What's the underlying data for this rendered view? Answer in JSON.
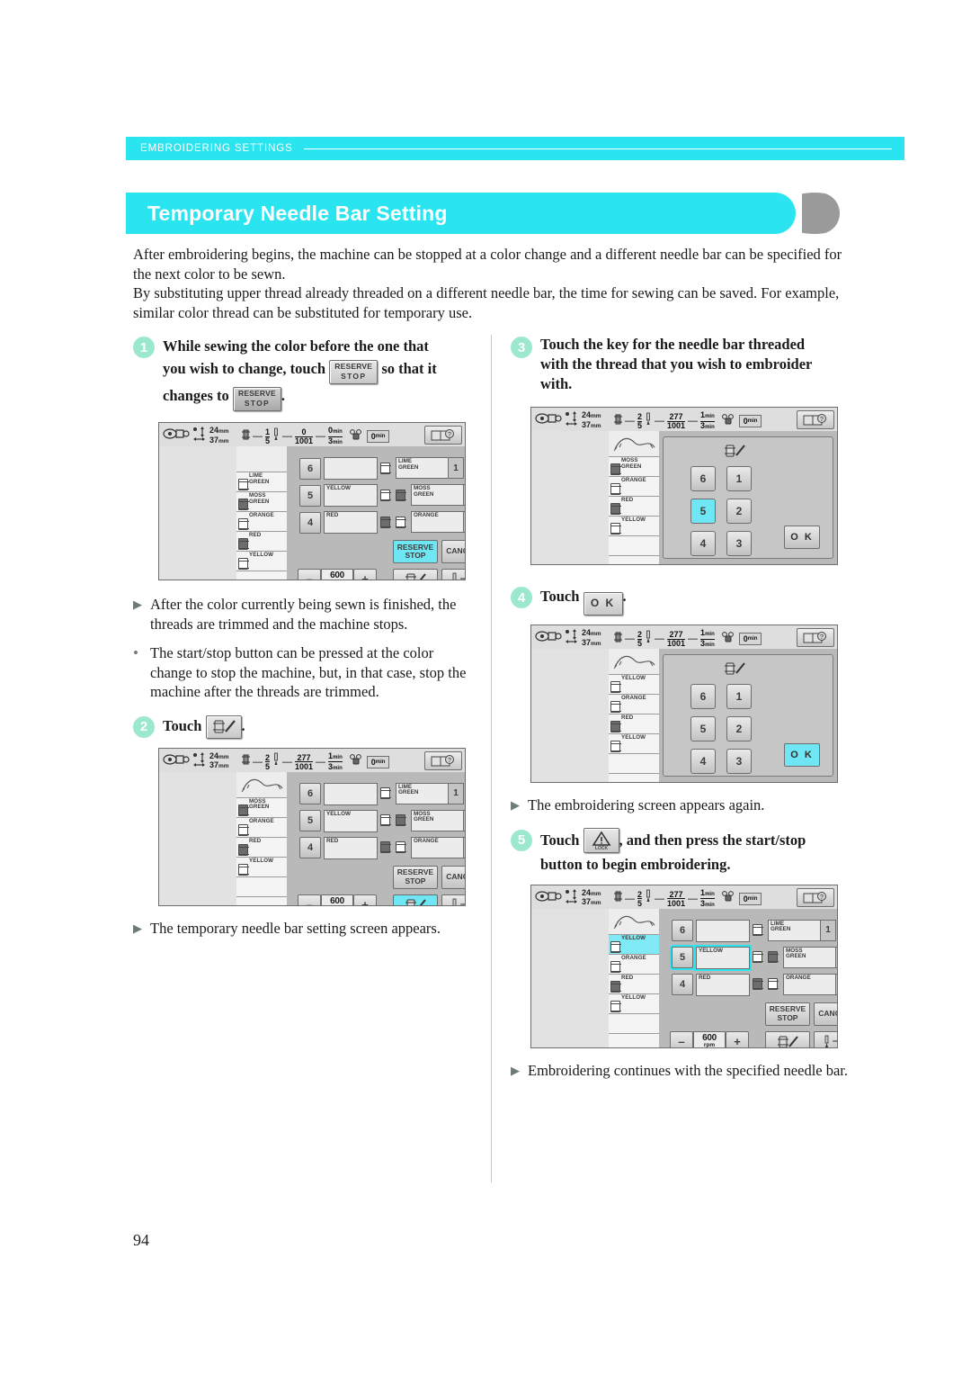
{
  "running_header": {
    "text": "EMBROIDERING SETTINGS"
  },
  "page_title": "Temporary Needle Bar Setting",
  "page_number": "94",
  "intro": {
    "p1": "After embroidering begins, the machine can be stopped at a color change and a different needle bar can be specified for the next color to be sewn.",
    "p2": "By substituting upper thread already threaded on a different needle bar, the time for sewing can be saved. For example, similar color thread can be substituted for temporary use."
  },
  "keys": {
    "reserve_line1": "RESERVE",
    "reserve_line2": "STOP",
    "ok": "O K",
    "cancel": "CANCEL",
    "lock": "LOCK",
    "speed_value": "600",
    "speed_unit": "rpm",
    "minus": "–",
    "plus": "+",
    "needle_pm": "–/+"
  },
  "steps": {
    "s1": {
      "num": "1",
      "t1": "While sewing the color before the one that",
      "t2a": "you wish to change, touch",
      "t2b": "so that it",
      "t3a": "changes to",
      "t3b": "."
    },
    "s2": {
      "num": "2",
      "label": "Touch",
      "tail": "."
    },
    "s3": {
      "num": "3",
      "t1": "Touch the key for the needle bar threaded",
      "t2": "with the thread that you wish to embroider",
      "t3": "with."
    },
    "s4": {
      "num": "4",
      "label": "Touch",
      "tail": "."
    },
    "s5": {
      "num": "5",
      "t1a": "Touch",
      "t1b": ", and then press the start/stop",
      "t2": "button to begin embroidering."
    }
  },
  "notes": {
    "n1": "After the color currently being sewn is finished, the threads are trimmed and the machine stops.",
    "n2": "The start/stop button can be pressed at the color change to stop the machine, but, in that case, stop the machine after the threads are trimmed.",
    "n3": "The temporary needle bar setting screen appears.",
    "n4": "The embroidering screen appears again.",
    "n5": "Embroidering continues with the specified needle bar."
  },
  "colors": {
    "accent_cyan": "#2ae4f0",
    "step_circle": "#9ce8cf",
    "lcd_bg": "#cfcfcf",
    "highlight": "#6fe6f3"
  },
  "lcd_screens": [
    {
      "id": "screen-step1",
      "size": {
        "height": "24",
        "width": "37",
        "unit": "mm"
      },
      "counter": {
        "color_current": "1",
        "color_total": "5",
        "stitch_current": "0",
        "stitch_total": "1001",
        "time_current": "0",
        "time_total": "3",
        "time_unit": "min",
        "elapsed": "0",
        "elapsed_unit": "min"
      },
      "thread_list": [
        {
          "name": "LIME GREEN",
          "index": "1",
          "shade": "light",
          "selected": false
        },
        {
          "name": "MOSS GREEN",
          "index": "2",
          "shade": "dark",
          "selected": false
        },
        {
          "name": "ORANGE",
          "index": "3",
          "shade": "light",
          "selected": false
        },
        {
          "name": "RED",
          "index": "4",
          "shade": "dark",
          "selected": false
        },
        {
          "name": "YELLOW",
          "index": "5",
          "shade": "light",
          "selected": false
        }
      ],
      "needle_left": [
        {
          "num": "6",
          "label": ""
        },
        {
          "num": "5",
          "label": "YELLOW"
        },
        {
          "num": "4",
          "label": "RED"
        }
      ],
      "needle_right": [
        {
          "label": "LIME GREEN",
          "num": "1"
        },
        {
          "label": "MOSS GREEN",
          "num": "2"
        },
        {
          "label": "ORANGE",
          "num": "3"
        }
      ],
      "reserve_active": true,
      "thread_button_active": false,
      "has_bottom_bar": true
    },
    {
      "id": "screen-step2",
      "size": {
        "height": "24",
        "width": "37",
        "unit": "mm"
      },
      "counter": {
        "color_current": "2",
        "color_total": "5",
        "stitch_current": "277",
        "stitch_total": "1001",
        "time_current": "1",
        "time_total": "3",
        "time_unit": "min",
        "elapsed": "0",
        "elapsed_unit": "min"
      },
      "thread_list": [
        {
          "name": "MOSS GREEN",
          "index": "2",
          "shade": "dark",
          "selected": false
        },
        {
          "name": "ORANGE",
          "index": "3",
          "shade": "light",
          "selected": false
        },
        {
          "name": "RED",
          "index": "4",
          "shade": "dark",
          "selected": false
        },
        {
          "name": "YELLOW",
          "index": "5",
          "shade": "light",
          "selected": false
        }
      ],
      "needle_left": [
        {
          "num": "6",
          "label": ""
        },
        {
          "num": "5",
          "label": "YELLOW"
        },
        {
          "num": "4",
          "label": "RED"
        }
      ],
      "needle_right": [
        {
          "label": "LIME GREEN",
          "num": "1"
        },
        {
          "label": "MOSS GREEN",
          "num": "2"
        },
        {
          "label": "ORANGE",
          "num": "3"
        }
      ],
      "reserve_active": false,
      "thread_button_active": true,
      "has_bottom_bar": true
    },
    {
      "id": "screen-step3",
      "size": {
        "height": "24",
        "width": "37",
        "unit": "mm"
      },
      "counter": {
        "color_current": "2",
        "color_total": "5",
        "stitch_current": "277",
        "stitch_total": "1001",
        "time_current": "1",
        "time_total": "3",
        "time_unit": "min",
        "elapsed": "0",
        "elapsed_unit": "min"
      },
      "thread_list": [
        {
          "name": "MOSS GREEN",
          "index": "2",
          "shade": "dark",
          "selected": false
        },
        {
          "name": "ORANGE",
          "index": "3",
          "shade": "light",
          "selected": false
        },
        {
          "name": "RED",
          "index": "4",
          "shade": "dark",
          "selected": false
        },
        {
          "name": "YELLOW",
          "index": "5",
          "shade": "light",
          "selected": false
        }
      ],
      "keypad": {
        "keys": [
          "6",
          "1",
          "5",
          "2",
          "4",
          "3"
        ],
        "selected": "5",
        "ok_label": "O K",
        "ok_active": false
      }
    },
    {
      "id": "screen-step4",
      "size": {
        "height": "24",
        "width": "37",
        "unit": "mm"
      },
      "counter": {
        "color_current": "2",
        "color_total": "5",
        "stitch_current": "277",
        "stitch_total": "1001",
        "time_current": "1",
        "time_total": "3",
        "time_unit": "min",
        "elapsed": "0",
        "elapsed_unit": "min"
      },
      "thread_list": [
        {
          "name": "YELLOW",
          "index": "5",
          "shade": "light",
          "selected": false
        },
        {
          "name": "ORANGE",
          "index": "3",
          "shade": "light",
          "selected": false
        },
        {
          "name": "RED",
          "index": "4",
          "shade": "dark",
          "selected": false
        },
        {
          "name": "YELLOW",
          "index": "5",
          "shade": "light",
          "selected": false
        }
      ],
      "keypad": {
        "keys": [
          "6",
          "1",
          "5",
          "2",
          "4",
          "3"
        ],
        "selected": "",
        "ok_label": "O K",
        "ok_active": true
      }
    },
    {
      "id": "screen-step5",
      "size": {
        "height": "24",
        "width": "37",
        "unit": "mm"
      },
      "counter": {
        "color_current": "2",
        "color_total": "5",
        "stitch_current": "277",
        "stitch_total": "1001",
        "time_current": "1",
        "time_total": "3",
        "time_unit": "min",
        "elapsed": "0",
        "elapsed_unit": "min"
      },
      "thread_list": [
        {
          "name": "YELLOW",
          "index": "5",
          "shade": "light",
          "selected": true
        },
        {
          "name": "ORANGE",
          "index": "3",
          "shade": "light",
          "selected": false
        },
        {
          "name": "RED",
          "index": "4",
          "shade": "dark",
          "selected": false
        },
        {
          "name": "YELLOW",
          "index": "5",
          "shade": "light",
          "selected": false
        }
      ],
      "needle_left": [
        {
          "num": "6",
          "label": ""
        },
        {
          "num": "5",
          "label": "YELLOW"
        },
        {
          "num": "4",
          "label": "RED"
        }
      ],
      "needle_right": [
        {
          "label": "LIME GREEN",
          "num": "1"
        },
        {
          "label": "MOSS GREEN",
          "num": "2"
        },
        {
          "label": "ORANGE",
          "num": "3"
        }
      ],
      "reserve_active": false,
      "thread_button_active": false,
      "selected_needle_row": 1,
      "has_bottom_bar": true
    }
  ]
}
